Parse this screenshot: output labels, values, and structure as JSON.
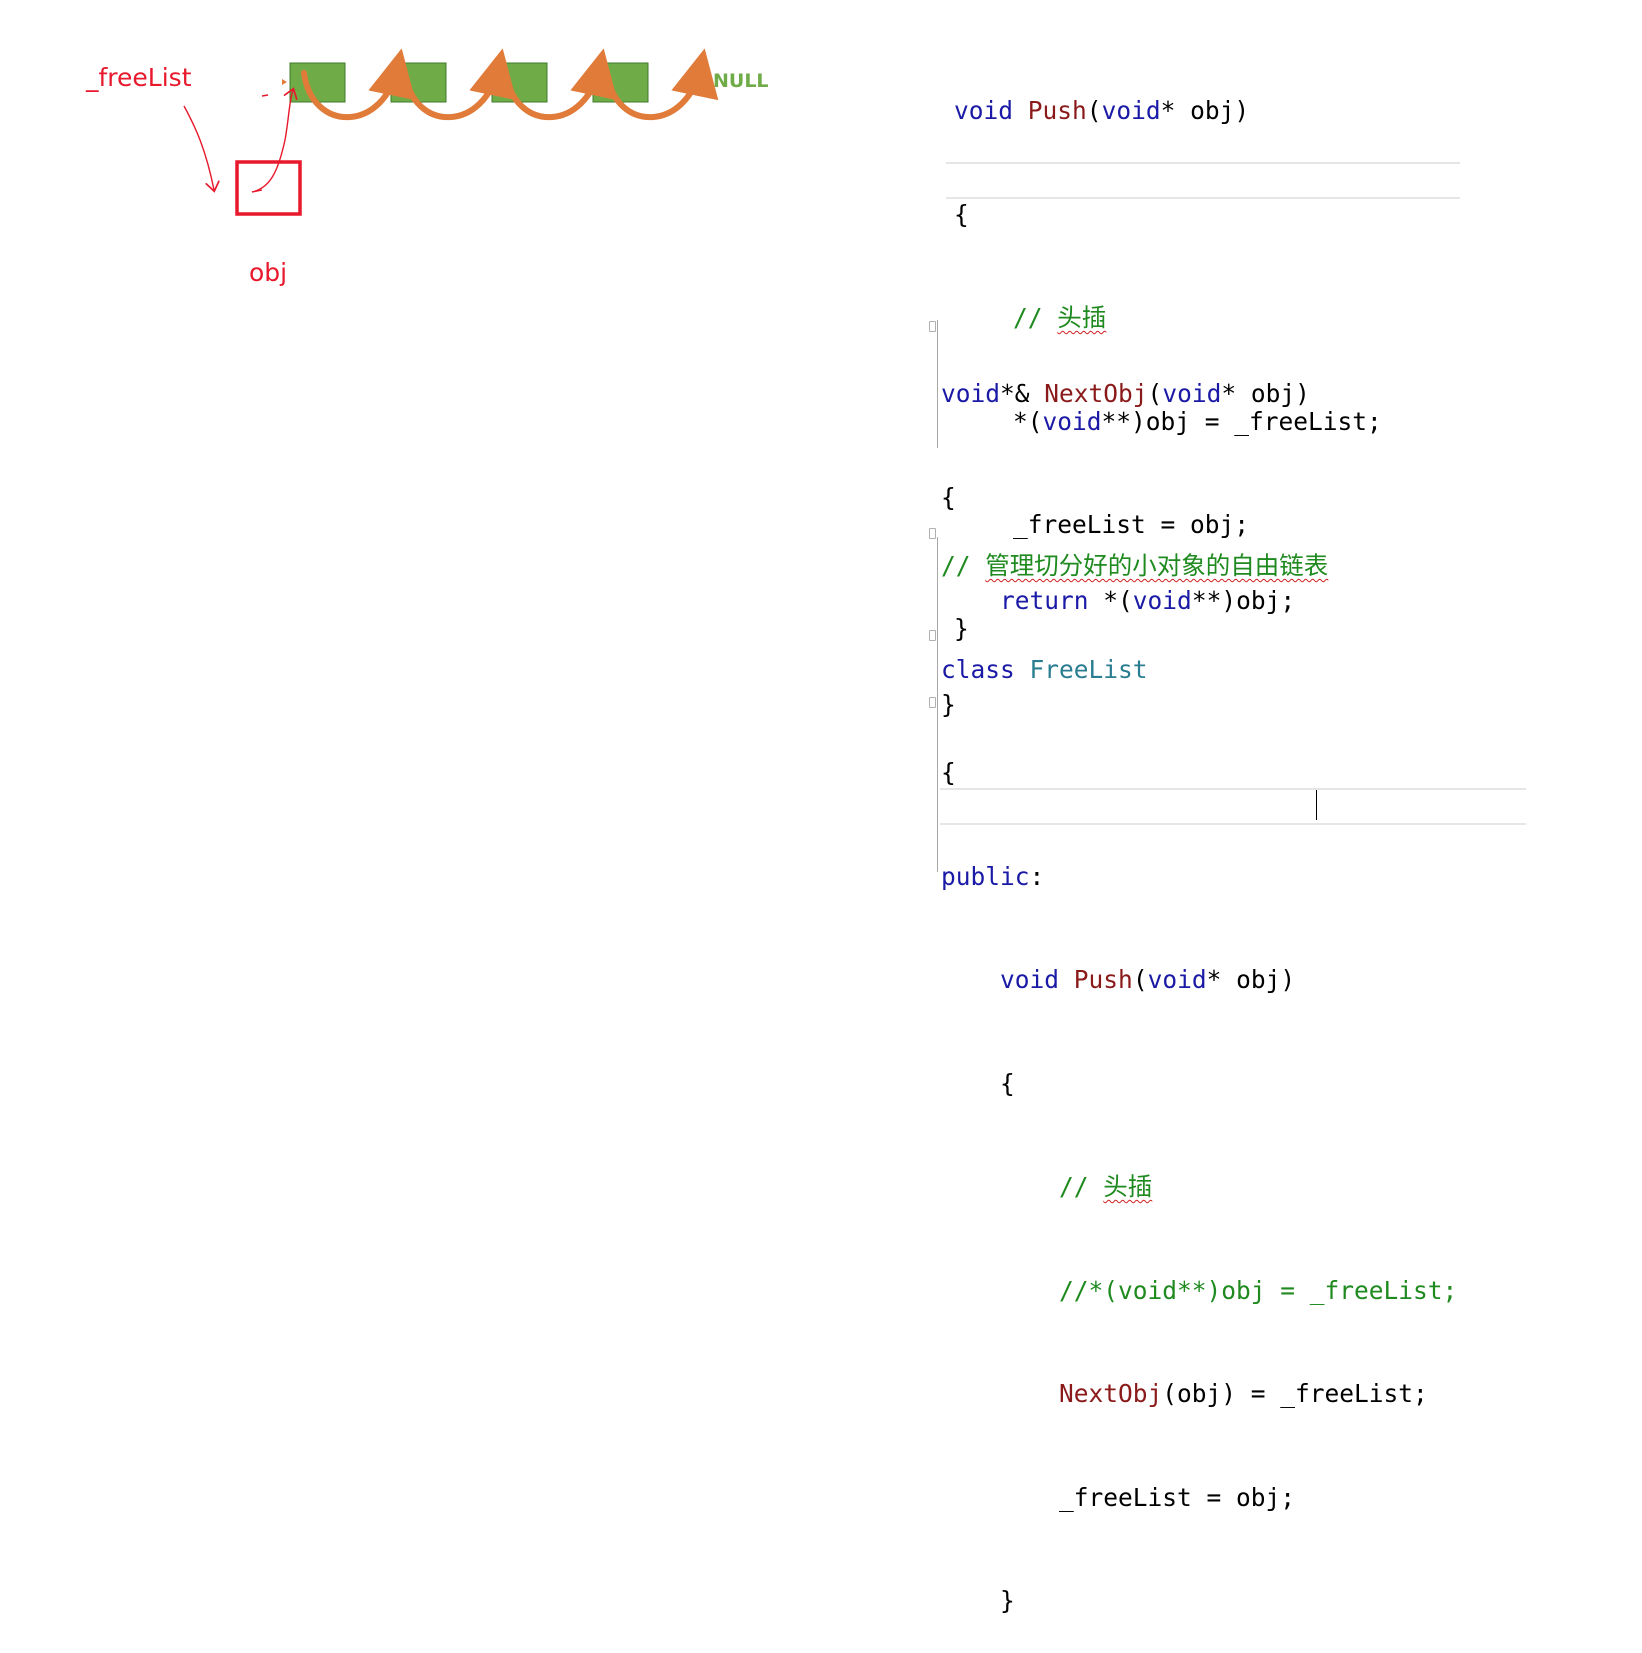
{
  "diagram": {
    "freelist_label": "_freeList",
    "obj_label": "obj",
    "null_label": "NULL",
    "node_count": 4,
    "colors": {
      "node": "#6fac47",
      "arrow": "#e07b39",
      "annotation": "#e8192c",
      "null": "#6fac47"
    }
  },
  "code1": {
    "sig": {
      "kw1": "void",
      "fn": "Push",
      "p1": "(",
      "kw2": "void",
      "p2": "* obj)"
    },
    "open": "{",
    "comment": {
      "slashes": "// ",
      "text": "头插"
    },
    "line3": {
      "a": "*(",
      "kw": "void",
      "b": "**)obj = _freeList;"
    },
    "line4": "_freeList = obj;",
    "close": "}"
  },
  "code2": {
    "sig": {
      "kw1": "void",
      "amp": "*& ",
      "fn": "NextObj",
      "p1": "(",
      "kw2": "void",
      "p2": "* obj)"
    },
    "open": "{",
    "ret": {
      "kw": "return",
      "a": " *(",
      "kw2": "void",
      "b": "**)obj;"
    },
    "close": "}"
  },
  "code3": {
    "comment": {
      "slashes": "// ",
      "text": "管理切分好的小对象的自由链表"
    },
    "classdecl": {
      "kw": "class",
      "name": "FreeList"
    },
    "open": "{",
    "access": {
      "kw": "public",
      "colon": ":"
    },
    "sig": {
      "kw1": "void",
      "fn": "Push",
      "p1": "(",
      "kw2": "void",
      "p2": "* obj)"
    },
    "open2": "{",
    "comment2": {
      "slashes": "// ",
      "text": "头插"
    },
    "commented": "//*(void**)obj = _freeList;",
    "nextobj": {
      "fn": "NextObj",
      "b": "(obj) = _freeList;"
    },
    "assign": "_freeList = obj;",
    "close2": "}"
  }
}
